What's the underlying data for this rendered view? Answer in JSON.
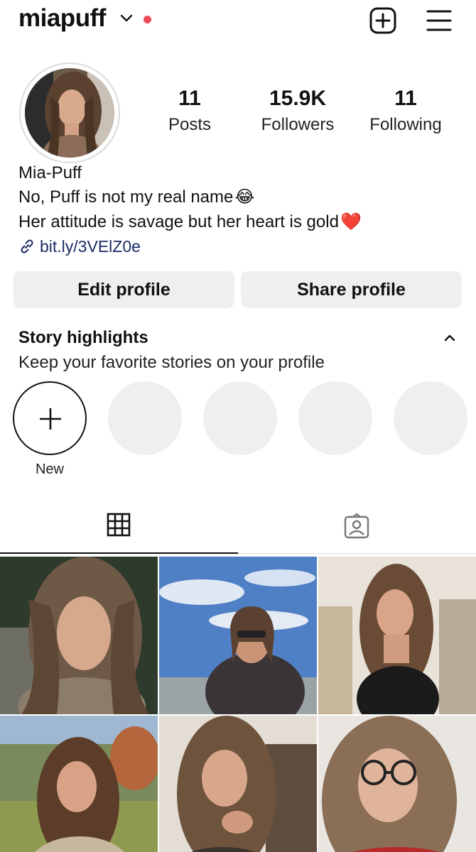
{
  "header": {
    "username": "miapuff"
  },
  "profile": {
    "stats": [
      {
        "value": "11",
        "label": "Posts"
      },
      {
        "value": "15.9K",
        "label": "Followers"
      },
      {
        "value": "11",
        "label": "Following"
      }
    ],
    "name": "Mia-Puff",
    "bio_line_1": "No, Puff is not my real name",
    "bio_emoji_1": "😂",
    "bio_line_2": "Her attitude is savage but her heart is gold",
    "bio_emoji_2": "❤️",
    "link": "bit.ly/3VElZ0e"
  },
  "actions": {
    "edit_label": "Edit profile",
    "share_label": "Share profile"
  },
  "highlights": {
    "title": "Story highlights",
    "subtitle": "Keep your favorite stories on your profile",
    "new_label": "New"
  },
  "tabs": {
    "active": "grid-icon",
    "items": [
      "grid-icon",
      "tagged-icon"
    ]
  },
  "colors": {
    "accent": "#ed4956",
    "link": "#1c2b66",
    "button_bg": "#efefef",
    "placeholder": "#efefef"
  },
  "posts_visible": 6
}
